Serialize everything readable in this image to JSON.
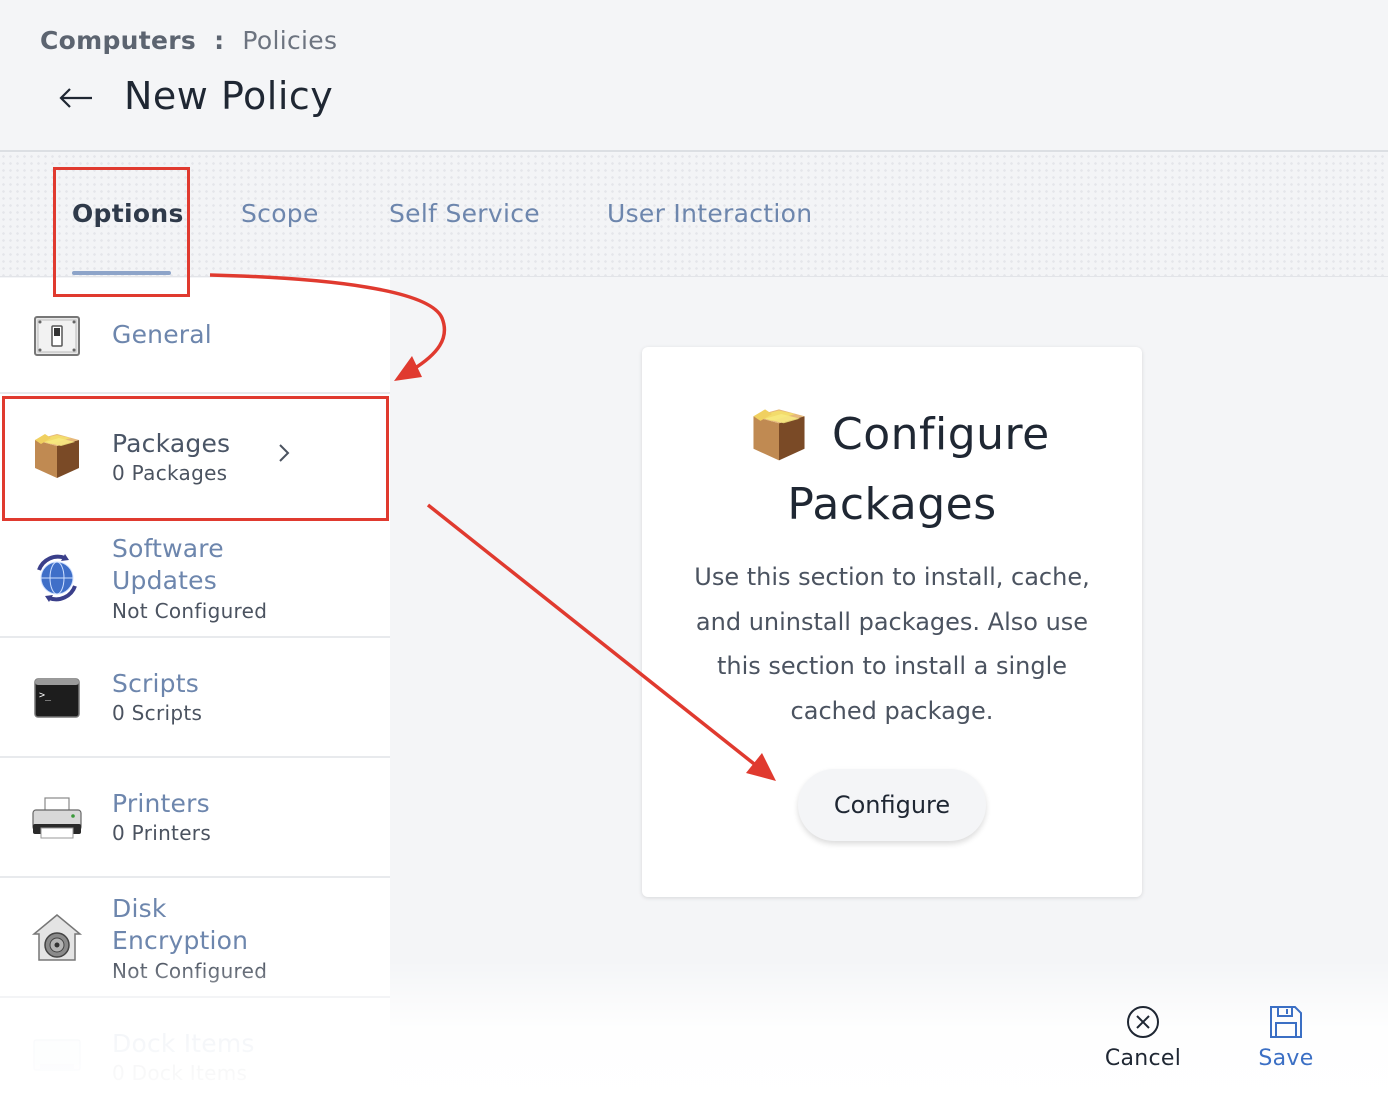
{
  "breadcrumb": {
    "root": "Computers",
    "separator": ":",
    "current": "Policies"
  },
  "page_title": "New Policy",
  "tabs": [
    {
      "label": "Options",
      "active": true
    },
    {
      "label": "Scope",
      "active": false
    },
    {
      "label": "Self Service",
      "active": false
    },
    {
      "label": "User Interaction",
      "active": false
    }
  ],
  "sidebar": {
    "items": [
      {
        "title": "General",
        "subtitle": "",
        "icon": "switch-icon"
      },
      {
        "title": "Packages",
        "subtitle": "0 Packages",
        "icon": "package-box-icon",
        "selected": true
      },
      {
        "title_line1": "Software",
        "title_line2": "Updates",
        "subtitle": "Not Configured",
        "icon": "software-update-icon"
      },
      {
        "title": "Scripts",
        "subtitle": "0 Scripts",
        "icon": "terminal-icon"
      },
      {
        "title": "Printers",
        "subtitle": "0 Printers",
        "icon": "printer-icon"
      },
      {
        "title_line1": "Disk",
        "title_line2": "Encryption",
        "subtitle": "Not Configured",
        "icon": "filevault-icon"
      },
      {
        "title": "Dock Items",
        "subtitle": "0 Dock Items",
        "icon": "dock-icon"
      }
    ]
  },
  "card": {
    "title_line1": "Configure",
    "title_line2": "Packages",
    "description": "Use this section to install, cache, and uninstall packages. Also use this section to install a single cached package.",
    "button_label": "Configure",
    "icon": "package-box-icon"
  },
  "footer": {
    "cancel_label": "Cancel",
    "save_label": "Save",
    "cancel_icon": "close-circle-icon",
    "save_icon": "floppy-disk-icon"
  },
  "colors": {
    "accent": "#6d86ad",
    "save_blue": "#3b6fc4",
    "annotation_red": "#e03a2f",
    "title_dark": "#1f2733"
  }
}
